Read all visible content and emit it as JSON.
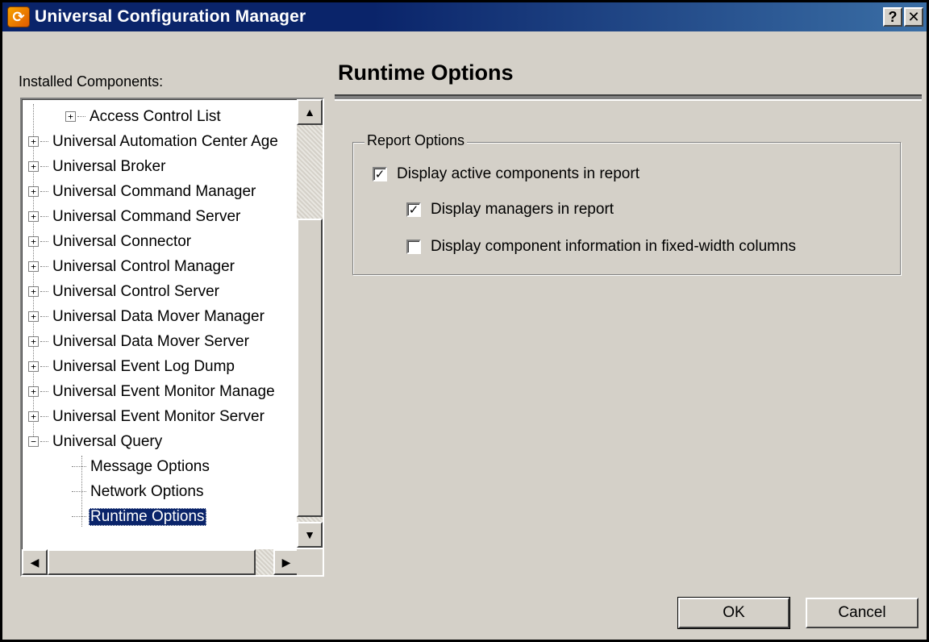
{
  "window": {
    "title": "Universal Configuration Manager",
    "help_glyph": "?",
    "close_glyph": "✕",
    "accent": "#0a246a"
  },
  "sidebar": {
    "label": "Installed Components:",
    "tree": [
      {
        "label": "Access Control List",
        "expander": "+"
      },
      {
        "label": "Universal Automation Center Age",
        "expander": "+"
      },
      {
        "label": "Universal Broker",
        "expander": "+"
      },
      {
        "label": "Universal Command Manager",
        "expander": "+"
      },
      {
        "label": "Universal Command Server",
        "expander": "+"
      },
      {
        "label": "Universal Connector",
        "expander": "+"
      },
      {
        "label": "Universal Control Manager",
        "expander": "+"
      },
      {
        "label": "Universal Control Server",
        "expander": "+"
      },
      {
        "label": "Universal Data Mover Manager",
        "expander": "+"
      },
      {
        "label": "Universal Data Mover Server",
        "expander": "+"
      },
      {
        "label": "Universal Event Log Dump",
        "expander": "+"
      },
      {
        "label": "Universal Event Monitor Manage",
        "expander": "+"
      },
      {
        "label": "Universal Event Monitor Server",
        "expander": "+"
      },
      {
        "label": "Universal Query",
        "expander": "−"
      },
      {
        "label": "Message Options",
        "expander": ""
      },
      {
        "label": "Network Options",
        "expander": ""
      },
      {
        "label": "Runtime Options",
        "expander": "",
        "selected": true
      }
    ]
  },
  "main": {
    "title": "Runtime Options",
    "group": {
      "legend": "Report Options",
      "options": [
        {
          "label": "Display active components in report",
          "checked": true
        },
        {
          "label": "Display managers in report",
          "checked": true
        },
        {
          "label": "Display component information in fixed-width columns",
          "checked": false
        }
      ]
    }
  },
  "buttons": {
    "ok": "OK",
    "cancel": "Cancel"
  },
  "icons": {
    "app": "uc-app-icon",
    "scroll_up": "▲",
    "scroll_down": "▼",
    "scroll_left": "◀",
    "scroll_right": "▶"
  }
}
